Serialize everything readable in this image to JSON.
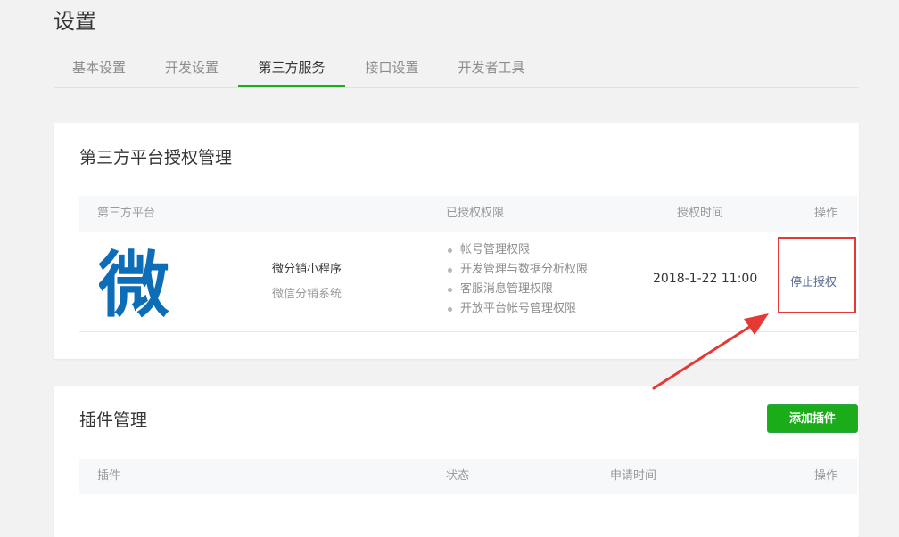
{
  "page": {
    "title": "设置"
  },
  "tabs": [
    {
      "label": "基本设置",
      "active": false
    },
    {
      "label": "开发设置",
      "active": false
    },
    {
      "label": "第三方服务",
      "active": true
    },
    {
      "label": "接口设置",
      "active": false
    },
    {
      "label": "开发者工具",
      "active": false
    }
  ],
  "third_party": {
    "title": "第三方平台授权管理",
    "columns": {
      "platform": "第三方平台",
      "permissions": "已授权权限",
      "time": "授权时间",
      "action": "操作"
    },
    "rows": [
      {
        "logo_char": "微",
        "name": "微分销小程序",
        "description": "微信分销系统",
        "permissions": [
          "帐号管理权限",
          "开发管理与数据分析权限",
          "客服消息管理权限",
          "开放平台帐号管理权限"
        ],
        "auth_time": "2018-1-22 11:00",
        "action_label": "停止授权"
      }
    ]
  },
  "plugins": {
    "title": "插件管理",
    "add_button": "添加插件",
    "columns": {
      "plugin": "插件",
      "status": "状态",
      "apply_time": "申请时间",
      "action": "操作"
    }
  },
  "colors": {
    "accent": "#1aad19",
    "link": "#576b95",
    "annotation": "#e53935",
    "logo": "#0e6db7"
  }
}
